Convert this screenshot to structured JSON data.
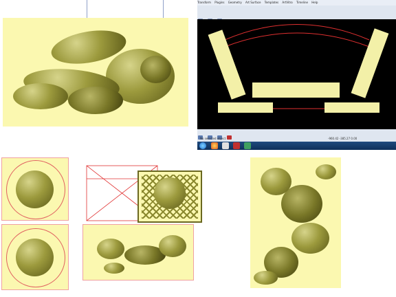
{
  "software_window": {
    "menu_items": [
      "Transform",
      "Plugins",
      "Geometry",
      "Art Surface",
      "Templates",
      "ArtVitro",
      "Timeline",
      "Help"
    ],
    "status_left": "No selected object",
    "status_right": "-960.42 -385.27 0.00"
  },
  "colors": {
    "ivory": "#fbf8b0",
    "relief_gold": "#9c9a3d",
    "guide_red": "#e03030",
    "canvas": "#000000"
  },
  "icons": [
    "relief-preview-icon",
    "taskbar-start-icon",
    "browser-icon",
    "app-icon"
  ]
}
